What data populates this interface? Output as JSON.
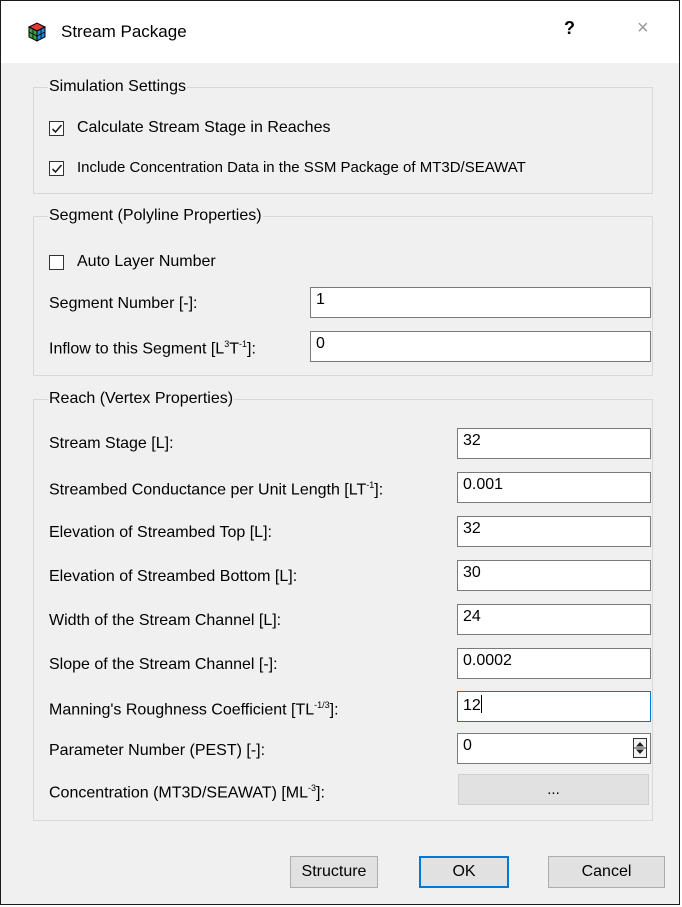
{
  "window": {
    "title": "Stream Package",
    "help_label": "?",
    "close_label": "×"
  },
  "simulation": {
    "legend": "Simulation Settings",
    "calc_stage": {
      "label": "Calculate Stream Stage in Reaches",
      "checked": true
    },
    "include_conc": {
      "label": "Include Concentration Data in the SSM Package of MT3D/SEAWAT",
      "checked": true
    }
  },
  "segment": {
    "legend": "Segment (Polyline Properties)",
    "auto_layer": {
      "label": "Auto Layer Number",
      "checked": false
    },
    "segment_number": {
      "label": "Segment Number [-]:",
      "value": "1"
    },
    "inflow": {
      "label_prefix": "Inflow to this Segment [L",
      "sup1": "3",
      "label_mid": "T",
      "sup2": "-1",
      "label_suffix": "]:",
      "value": "0"
    }
  },
  "reach": {
    "legend": "Reach (Vertex Properties)",
    "stream_stage": {
      "label": "Stream Stage [L]:",
      "value": "32"
    },
    "conductance": {
      "label_prefix": "Streambed Conductance per Unit Length [LT",
      "sup": "-1",
      "label_suffix": "]:",
      "value": "0.001"
    },
    "top": {
      "label": "Elevation of Streambed Top  [L]:",
      "value": "32"
    },
    "bottom": {
      "label": "Elevation of Streambed Bottom [L]:",
      "value": "30"
    },
    "width": {
      "label": "Width of the Stream Channel [L]:",
      "value": "24"
    },
    "slope": {
      "label": "Slope of the Stream Channel [-]:",
      "value": "0.0002"
    },
    "manning": {
      "label_prefix": "Manning's Roughness Coefficient [TL",
      "sup": "-1/3",
      "label_suffix": "]:",
      "value": "12"
    },
    "param": {
      "label": "Parameter Number (PEST) [-]:",
      "value": "0"
    },
    "conc": {
      "label_prefix": "Concentration (MT3D/SEAWAT) [ML",
      "sup": "-3",
      "label_suffix": "]:",
      "button_label": "..."
    }
  },
  "buttons": {
    "structure": "Structure",
    "ok": "OK",
    "cancel": "Cancel"
  }
}
